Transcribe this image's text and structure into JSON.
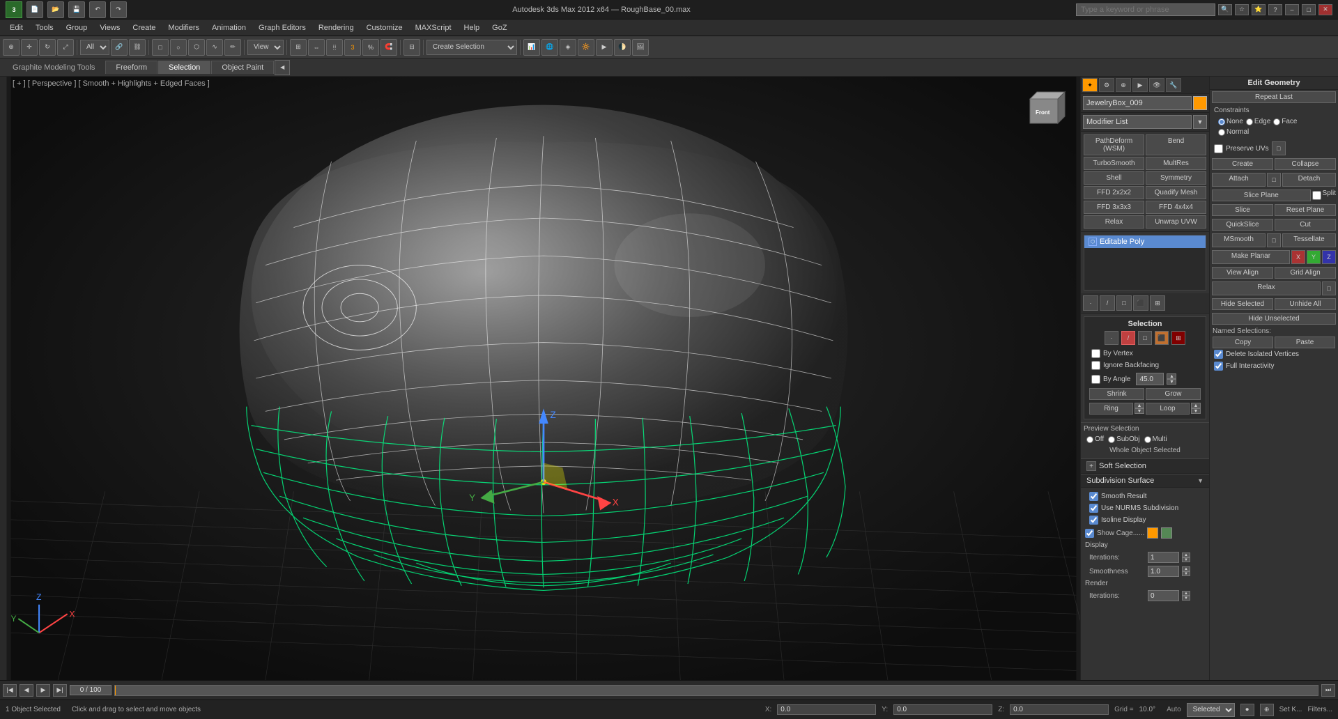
{
  "titlebar": {
    "app_title": "Autodesk 3ds Max 2012 x64",
    "file_name": "RoughBase_00.max",
    "search_placeholder": "Type a keyword or phrase",
    "min_label": "–",
    "max_label": "□",
    "close_label": "✕"
  },
  "menubar": {
    "items": [
      "Edit",
      "Tools",
      "Group",
      "Views",
      "Create",
      "Modifiers",
      "Animation",
      "Graph Editors",
      "Rendering",
      "Customize",
      "MAXScript",
      "Help",
      "GoZ"
    ]
  },
  "ribbon": {
    "app_label": "Graphite Modeling Tools",
    "tabs": [
      "Freeform",
      "Selection",
      "Object Paint"
    ],
    "active_tab": "Selection",
    "icon_label": "◀"
  },
  "viewport": {
    "label": "[ + ] [ Perspective ] [ Smooth + Highlights + Edged Faces ]"
  },
  "right_panel": {
    "object_name": "JewelryBox_009",
    "modifier_list_label": "Modifier List",
    "modifiers": {
      "buttons": [
        [
          "PathDeform (WSM)",
          "Bend"
        ],
        [
          "TurboSmooth",
          "MultRes"
        ],
        [
          "Shell",
          "Symmetry"
        ],
        [
          "FFD 2x2x2",
          "Quadify Mesh"
        ],
        [
          "FFD 3x3x3",
          "FFD 4x4x4"
        ],
        [
          "Relax",
          "Unwrap UVW"
        ]
      ],
      "stack_item": "Editable Poly"
    }
  },
  "edit_geometry": {
    "title": "Edit Geometry",
    "repeat_last": "Repeat Last",
    "constraints": {
      "label": "Constraints",
      "options": [
        "None",
        "Edge",
        "Face",
        "Normal"
      ]
    },
    "preserve_uvs_label": "Preserve UVs",
    "create_btn": "Create",
    "collapse_btn": "Collapse",
    "attach_btn": "Attach",
    "detach_btn": "Detach",
    "slice_plane_btn": "Slice Plane",
    "split_label": "Split",
    "slice_btn": "Slice",
    "reset_plane_btn": "Reset Plane",
    "quickslice_btn": "QuickSlice",
    "cut_btn": "Cut",
    "msmooth_btn": "MSmooth",
    "tessellate_btn": "Tessellate",
    "make_planar_btn": "Make Planar",
    "x_btn": "X",
    "y_btn": "Y",
    "z_btn": "Z",
    "view_align_btn": "View Align",
    "grid_align_btn": "Grid Align",
    "relax_btn": "Relax",
    "hide_selected_btn": "Hide Selected",
    "unhide_all_btn": "Unhide All",
    "hide_unselected_btn": "Hide Unselected",
    "named_selections_label": "Named Selections:",
    "copy_btn": "Copy",
    "paste_btn": "Paste",
    "delete_isolated_label": "Delete Isolated Vertices",
    "full_interactivity_label": "Full Interactivity"
  },
  "selection_section": {
    "title": "Selection",
    "by_vertex_label": "By Vertex",
    "ignore_backfacing_label": "Ignore Backfacing",
    "by_angle_label": "By Angle",
    "angle_value": "45.0",
    "shrink_btn": "Shrink",
    "grow_btn": "Grow",
    "ring_btn": "Ring",
    "loop_btn": "Loop",
    "preview_sel_label": "Preview Selection",
    "off_label": "Off",
    "subobj_label": "SubObj",
    "multi_label": "Multi",
    "whole_obj_selected": "Whole Object Selected"
  },
  "subdivision_surface": {
    "title": "Subdivision Surface",
    "smooth_result_label": "Smooth Result",
    "use_nurms_label": "Use NURMS Subdivision",
    "isoline_label": "Isoline Display",
    "show_cage_label": "Show Cage......",
    "display_label": "Display",
    "iterations_label": "Iterations:",
    "iterations_value": "1",
    "smoothness_label": "Smoothness",
    "smoothness_value": "1.0",
    "render_label": "Render",
    "render_iterations_label": "Iterations:",
    "render_iterations_value": "0"
  },
  "soft_selection": {
    "title": "Soft Selection"
  },
  "timeline": {
    "frame_value": "0 / 100"
  },
  "statusbar": {
    "objects_selected": "1 Object Selected",
    "hint": "Click and drag to select and move objects",
    "x_label": "X:",
    "y_label": "Y:",
    "z_label": "Z:",
    "x_val": "0.0",
    "y_val": "0.0",
    "z_val": "0.0",
    "grid_label": "Grid =",
    "grid_val": "10.0°",
    "auto_label": "Auto",
    "selected_label": "Selected",
    "set_k_label": "Set K...",
    "filters_label": "Filters..."
  }
}
